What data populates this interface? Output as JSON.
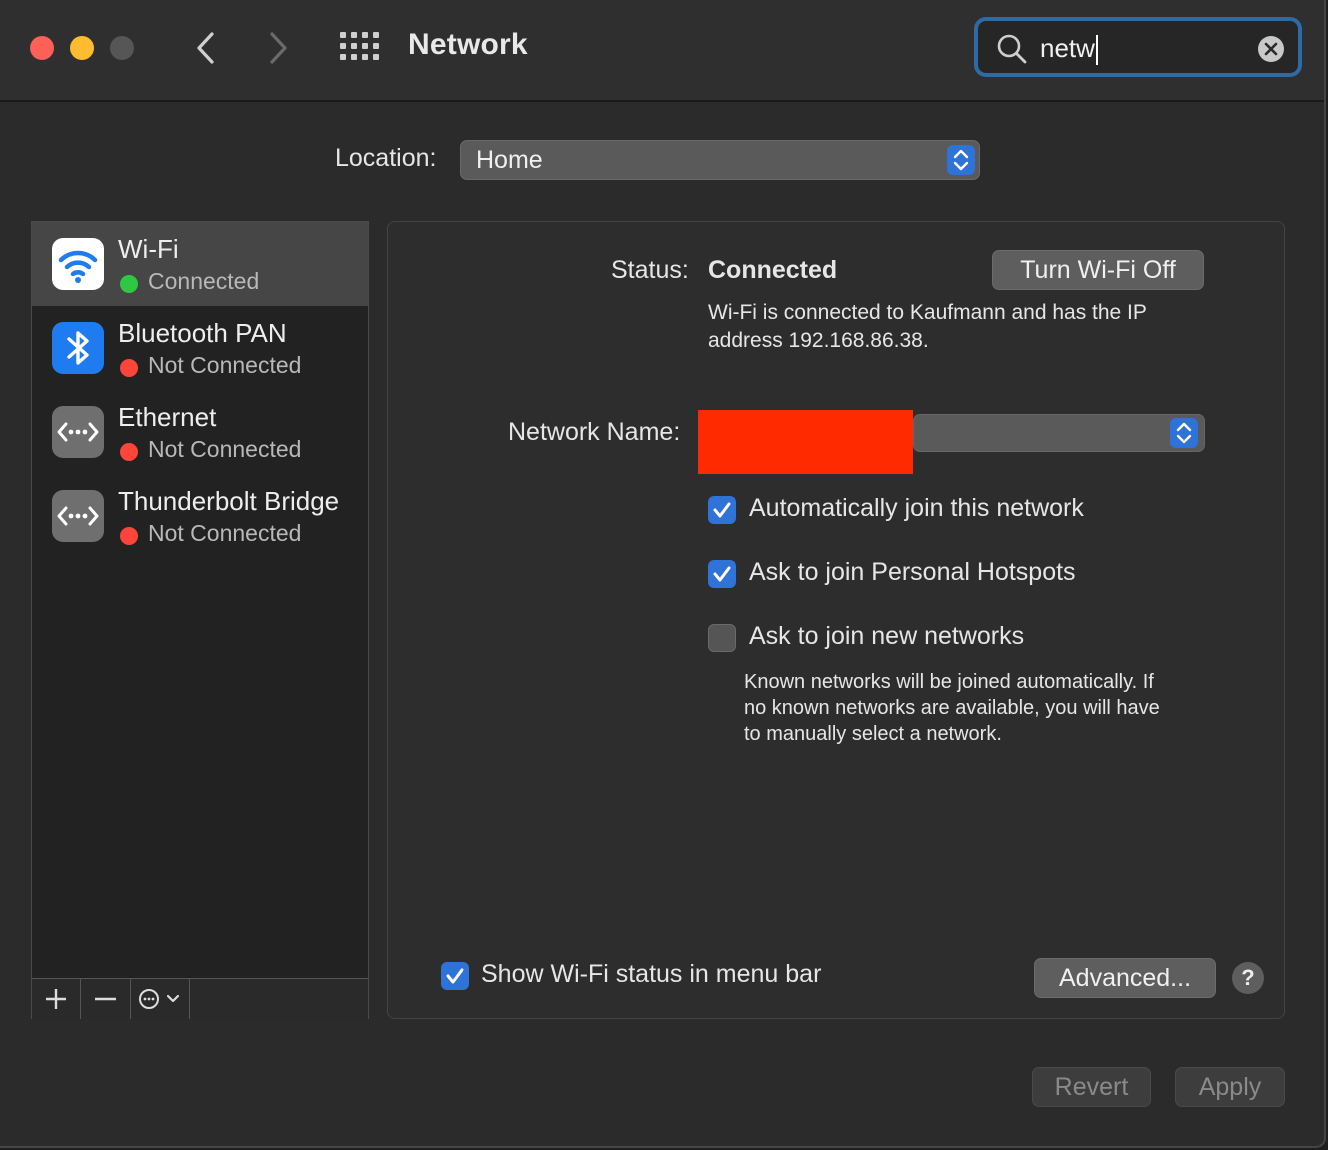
{
  "window": {
    "title": "Network",
    "search": {
      "value": "netw",
      "placeholder": "Search"
    }
  },
  "location": {
    "label": "Location:",
    "value": "Home"
  },
  "services": [
    {
      "name": "Wi-Fi",
      "status": "Connected",
      "status_color": "#2fc843",
      "icon": "wifi-icon",
      "selected": true
    },
    {
      "name": "Bluetooth PAN",
      "status": "Not Connected",
      "status_color": "#fe453a",
      "icon": "bluetooth-icon",
      "selected": false
    },
    {
      "name": "Ethernet",
      "status": "Not Connected",
      "status_color": "#fe453a",
      "icon": "ethernet-icon",
      "selected": false
    },
    {
      "name": "Thunderbolt Bridge",
      "status": "Not Connected",
      "status_color": "#fe453a",
      "icon": "thunderbolt-bridge-icon",
      "selected": false
    }
  ],
  "sidebar_tools": {
    "add": "+",
    "remove": "—",
    "more": "action-menu-icon"
  },
  "detail": {
    "status_label": "Status:",
    "status_value": "Connected",
    "toggle_button": "Turn Wi-Fi Off",
    "status_description_line1": "Wi-Fi is connected to Kaufmann and has the IP",
    "status_description_line2": "address 192.168.86.38.",
    "network_name_label": "Network Name:",
    "options": [
      {
        "label": "Automatically join this network",
        "checked": true
      },
      {
        "label": "Ask to join Personal Hotspots",
        "checked": true
      },
      {
        "label": "Ask to join new networks",
        "checked": false
      }
    ],
    "new_networks_note_line1": "Known networks will be joined automatically. If",
    "new_networks_note_line2": "no known networks are available, you will have",
    "new_networks_note_line3": "to manually select a network.",
    "show_status_label": "Show Wi-Fi status in menu bar",
    "show_status_checked": true,
    "advanced_button": "Advanced...",
    "help_button": "?"
  },
  "footer": {
    "revert": "Revert",
    "apply": "Apply"
  },
  "colors": {
    "accent": "#2f72d8",
    "search_ring": "#2d6aa6",
    "redaction": "#ff2a00"
  }
}
